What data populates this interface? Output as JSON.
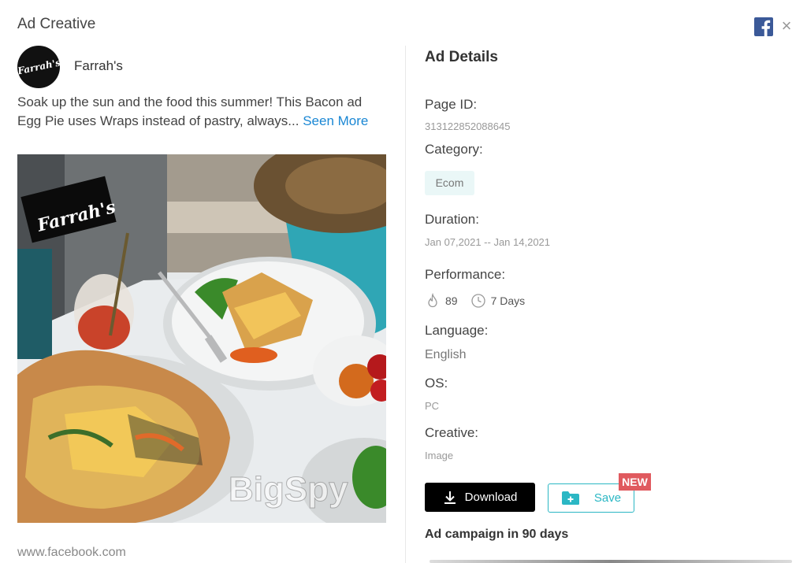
{
  "header": {
    "title": "Ad Creative",
    "facebook_icon": "facebook-icon",
    "close_symbol": "×"
  },
  "advertiser": {
    "name": "Farrah's",
    "avatar_text": "Farrah's"
  },
  "ad": {
    "text": "Soak up the sun and the food this summer! This Bacon ad Egg Pie uses Wraps instead of pastry, always...",
    "see_more": "Seen More",
    "image_logo_text": "Farrah's",
    "watermark": "BigSpy",
    "url": "www.facebook.com"
  },
  "details": {
    "title": "Ad Details",
    "page_id_label": "Page ID:",
    "page_id": "313122852088645",
    "category_label": "Category:",
    "category": "Ecom",
    "duration_label": "Duration:",
    "duration": "Jan 07,2021 -- Jan 14,2021",
    "performance_label": "Performance:",
    "likes": "89",
    "days": "7 Days",
    "language_label": "Language:",
    "language": "English",
    "os_label": "OS:",
    "os": "PC",
    "creative_label": "Creative:",
    "creative": "Image"
  },
  "actions": {
    "download_label": "Download",
    "save_label": "Save",
    "new_badge": "NEW"
  },
  "campaign": {
    "title": "Ad campaign in 90 days"
  },
  "colors": {
    "accent": "#2bb7c4",
    "link": "#1a87d4",
    "badge": "#e05a5f",
    "facebook": "#3b5998"
  }
}
